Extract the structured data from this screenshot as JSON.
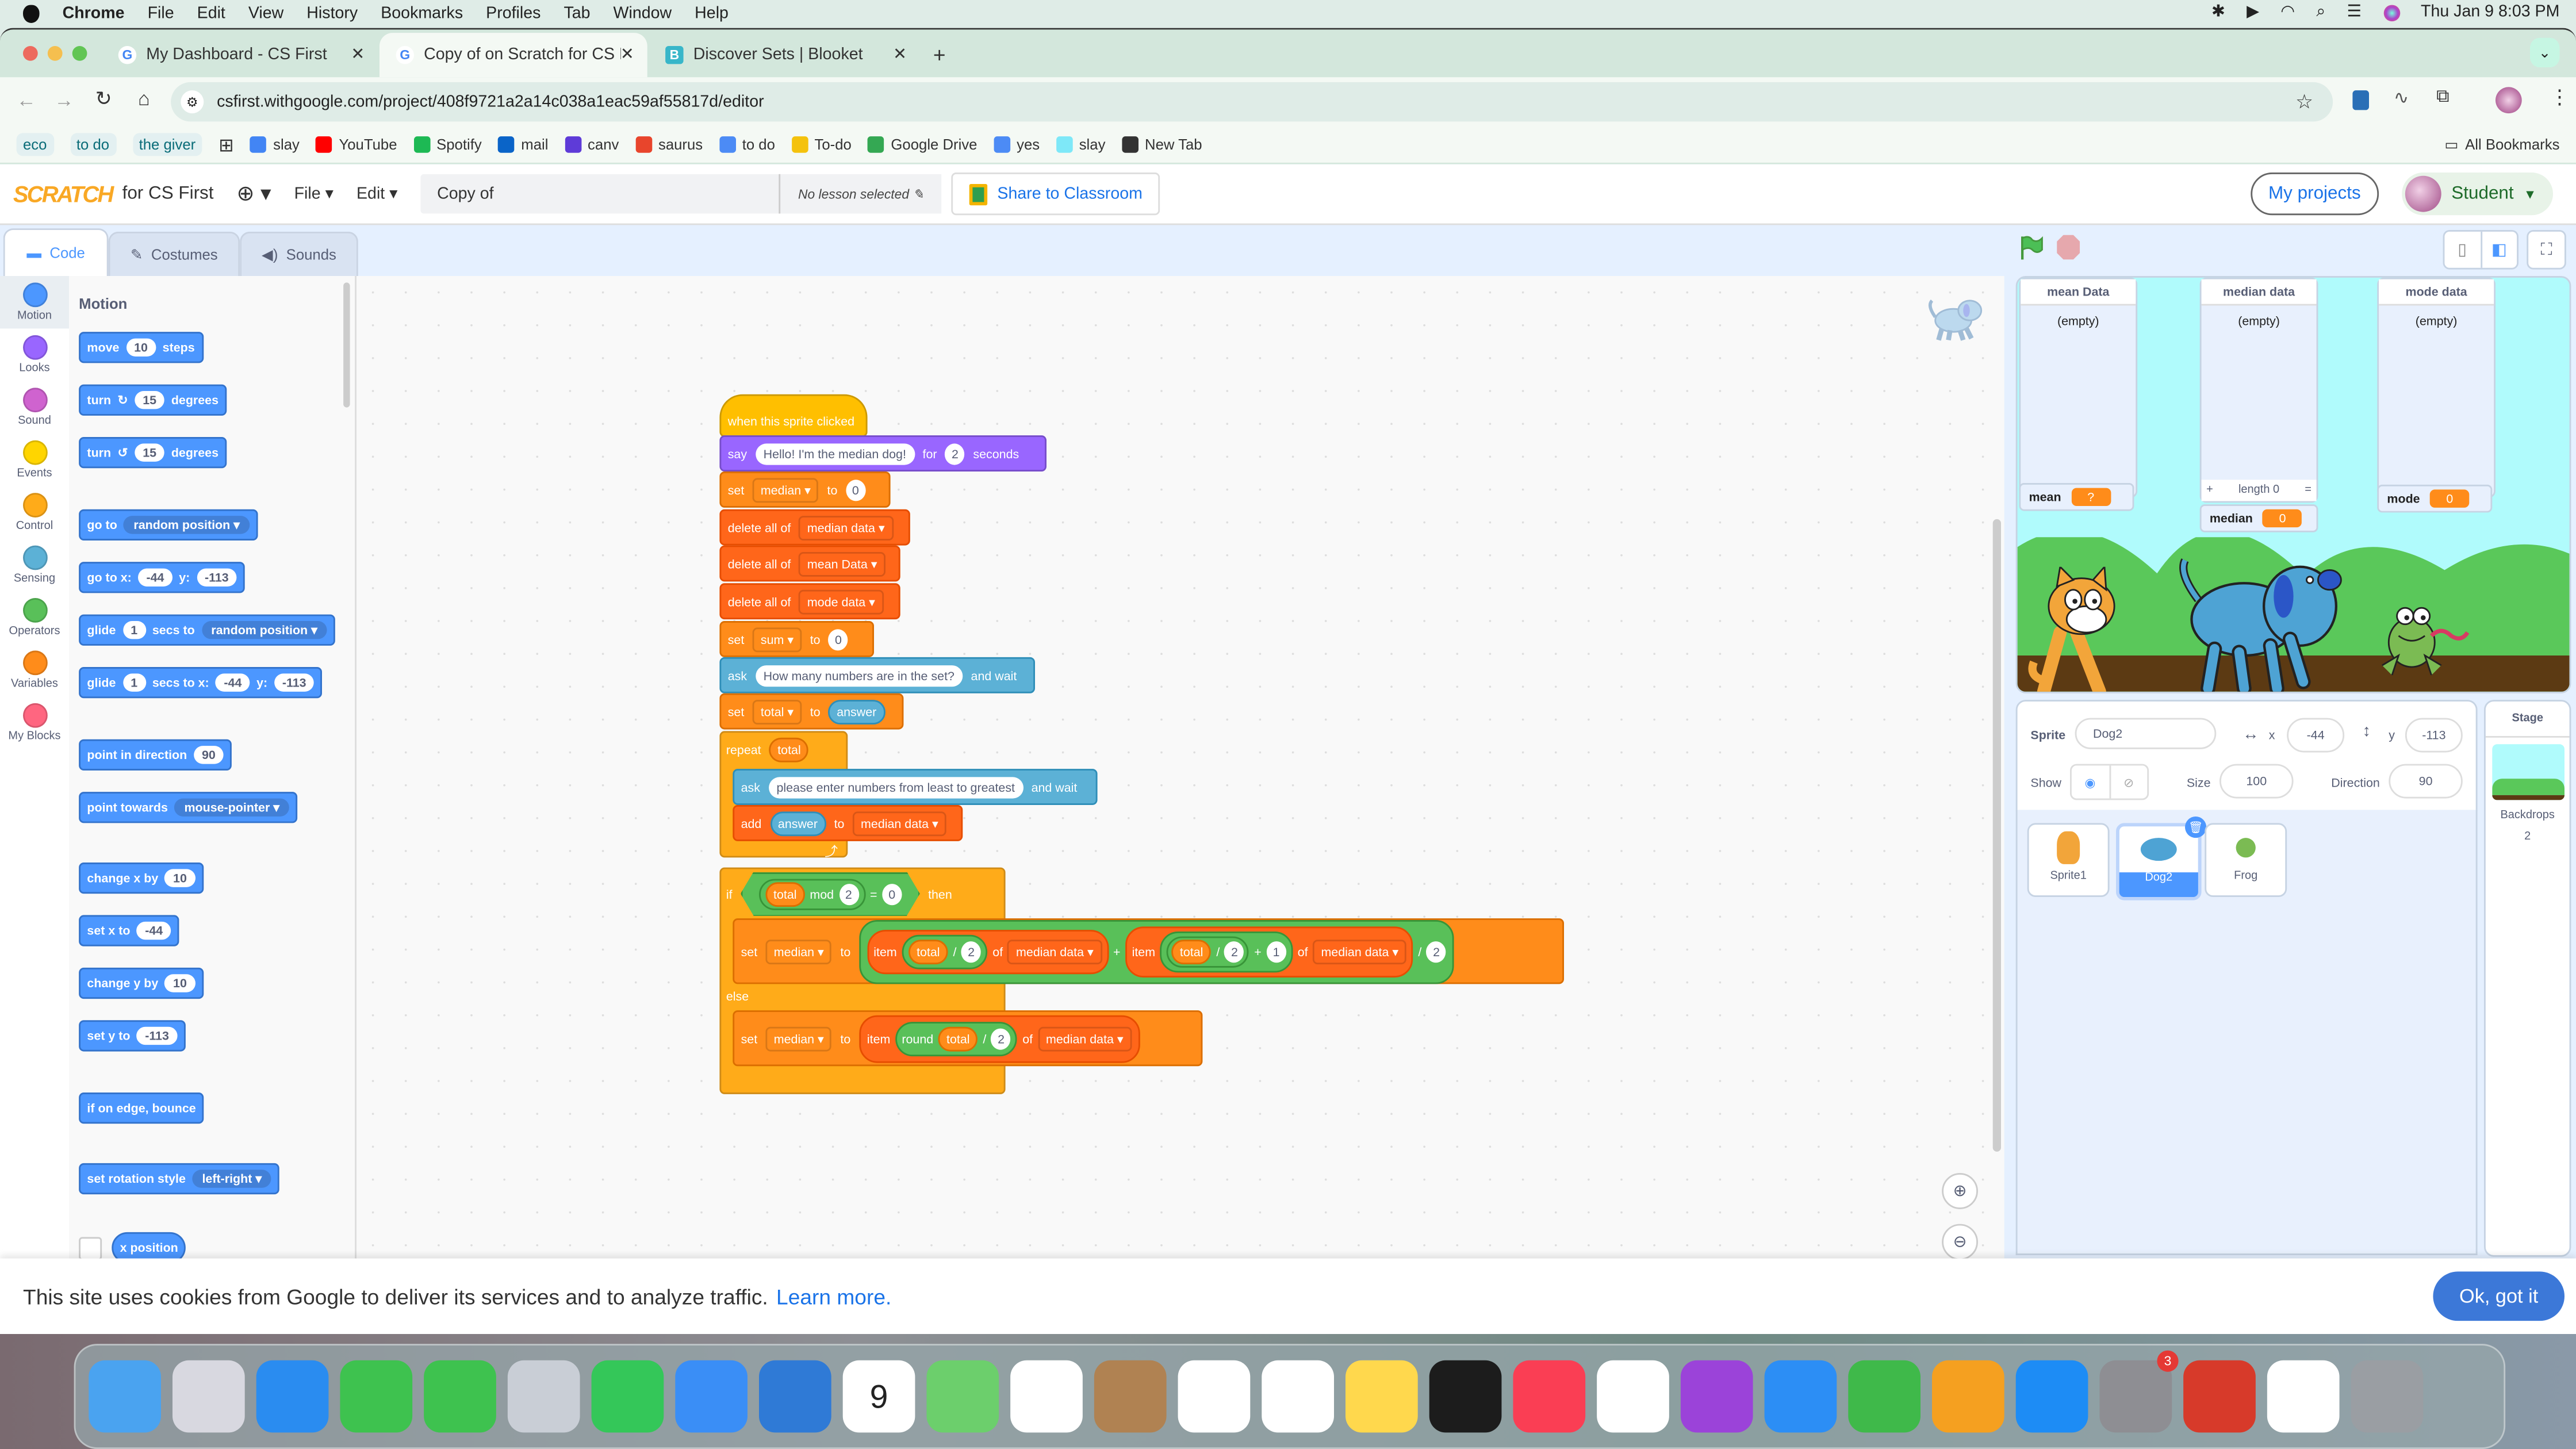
{
  "menubar": {
    "app": "Chrome",
    "items": [
      "File",
      "Edit",
      "View",
      "History",
      "Bookmarks",
      "Profiles",
      "Tab",
      "Window",
      "Help"
    ],
    "clock": "Thu Jan 9  8:03 PM"
  },
  "browser": {
    "tabs": [
      {
        "title": "My Dashboard - CS First",
        "icon": "google-icon",
        "active": false
      },
      {
        "title": "Copy of on Scratch for CS Fir",
        "icon": "google-icon",
        "active": true
      },
      {
        "title": "Discover Sets | Blooket",
        "icon": "blooket-icon",
        "active": false
      }
    ],
    "url": "csfirst.withgoogle.com/project/408f9721a2a14c038a1eac59af55817d/editor",
    "bookmarks": [
      {
        "label": "eco",
        "type": "chip"
      },
      {
        "label": "to do",
        "type": "chip"
      },
      {
        "label": "the giver",
        "type": "chip"
      },
      {
        "label": "slay",
        "icon": "classroom-icon",
        "color": "#4285f4"
      },
      {
        "label": "YouTube",
        "icon": "youtube-icon",
        "color": "#ff0000"
      },
      {
        "label": "Spotify",
        "icon": "spotify-icon",
        "color": "#1db954"
      },
      {
        "label": "mail",
        "icon": "outlook-icon",
        "color": "#0a64c8"
      },
      {
        "label": "canv",
        "icon": "canva-icon",
        "color": "#5e3bd8"
      },
      {
        "label": "saurus",
        "icon": "thesaurus-icon",
        "color": "#e8452c"
      },
      {
        "label": "to do",
        "icon": "docs-icon",
        "color": "#4c8bf5"
      },
      {
        "label": "To-do",
        "icon": "classroom-icon",
        "color": "#f4c20d"
      },
      {
        "label": "Google Drive",
        "icon": "drive-icon",
        "color": "#34a853"
      },
      {
        "label": "yes",
        "icon": "docs-icon",
        "color": "#4c8bf5"
      },
      {
        "label": "slay",
        "icon": "head-icon",
        "color": "#7ee8f8"
      },
      {
        "label": "New Tab",
        "icon": "globe-icon",
        "color": "#333333"
      }
    ],
    "all_bookmarks": "All Bookmarks"
  },
  "scratch": {
    "logo": "SCRATCH",
    "subtitle": "for CS First",
    "menus": [
      "File",
      "Edit"
    ],
    "project_title": "Copy of",
    "lesson": "No lesson selected",
    "share": "Share to Classroom",
    "my_projects": "My projects",
    "user": "Student",
    "tabs": [
      "Code",
      "Costumes",
      "Sounds"
    ],
    "categories": [
      {
        "label": "Motion",
        "color": "#4c97ff"
      },
      {
        "label": "Looks",
        "color": "#9966ff"
      },
      {
        "label": "Sound",
        "color": "#cf63cf"
      },
      {
        "label": "Events",
        "color": "#ffd500"
      },
      {
        "label": "Control",
        "color": "#ffab19"
      },
      {
        "label": "Sensing",
        "color": "#5cb1d6"
      },
      {
        "label": "Operators",
        "color": "#59c059"
      },
      {
        "label": "Variables",
        "color": "#ff8c1a"
      },
      {
        "label": "My Blocks",
        "color": "#ff6680"
      }
    ],
    "palette_title": "Motion",
    "palette": [
      {
        "parts": [
          "move",
          "#10",
          "steps"
        ]
      },
      {
        "parts": [
          "turn",
          "↻",
          "#15",
          "degrees"
        ]
      },
      {
        "parts": [
          "turn",
          "↺",
          "#15",
          "degrees"
        ]
      },
      {
        "parts": [
          "go to",
          "@random position"
        ]
      },
      {
        "parts": [
          "go to x:",
          "#-44",
          "y:",
          "#-113"
        ]
      },
      {
        "parts": [
          "glide",
          "#1",
          "secs to",
          "@random position"
        ]
      },
      {
        "parts": [
          "glide",
          "#1",
          "secs to x:",
          "#-44",
          "y:",
          "#-113"
        ]
      },
      {
        "parts": [
          "point in direction",
          "#90"
        ]
      },
      {
        "parts": [
          "point towards",
          "@mouse-pointer"
        ]
      },
      {
        "parts": [
          "change x by",
          "#10"
        ]
      },
      {
        "parts": [
          "set x to",
          "#-44"
        ]
      },
      {
        "parts": [
          "change y by",
          "#10"
        ]
      },
      {
        "parts": [
          "set y to",
          "#-113"
        ]
      },
      {
        "parts": [
          "if on edge, bounce"
        ]
      },
      {
        "parts": [
          "set rotation style",
          "@left-right"
        ]
      },
      {
        "parts": [
          "x position"
        ]
      }
    ],
    "script": {
      "hat": "when this sprite clicked",
      "say": {
        "kw": "say",
        "msg": "Hello! I'm the median dog!",
        "for": "for",
        "secs": "2",
        "unit": "seconds"
      },
      "set_median": {
        "kw": "set",
        "var": "median",
        "to": "to",
        "val": "0"
      },
      "del1": {
        "kw": "delete all of",
        "list": "median data"
      },
      "del2": {
        "kw": "delete all of",
        "list": "mean Data"
      },
      "del3": {
        "kw": "delete all of",
        "list": "mode data"
      },
      "set_sum": {
        "kw": "set",
        "var": "sum",
        "to": "to",
        "val": "0"
      },
      "ask1": {
        "kw": "ask",
        "q": "How many numbers are in the set?",
        "wait": "and wait"
      },
      "set_total": {
        "kw": "set",
        "var": "total",
        "to": "to",
        "val": "answer"
      },
      "repeat": {
        "kw": "repeat",
        "val": "total"
      },
      "ask2": {
        "kw": "ask",
        "q": "please enter numbers from least to greatest",
        "wait": "and wait"
      },
      "add": {
        "kw": "add",
        "val": "answer",
        "to": "to",
        "list": "median data"
      },
      "if": {
        "kw": "if",
        "a": "total",
        "mod": "mod",
        "b": "2",
        "eq": "=",
        "c": "0",
        "then": "then"
      },
      "set_even": {
        "kw": "set",
        "var": "median",
        "to": "to",
        "item": "item",
        "a": "total",
        "div": "/",
        "b": "2",
        "of": "of",
        "list": "median data",
        "plus": "+",
        "item2": "item",
        "a2": "total",
        "b2": "2",
        "plus2": "+",
        "c2": "1",
        "of2": "of",
        "list2": "median data",
        "div2": "/",
        "d": "2"
      },
      "else": "else",
      "set_odd": {
        "kw": "set",
        "var": "median",
        "to": "to",
        "item": "item",
        "round": "round",
        "a": "total",
        "div": "/",
        "b": "2",
        "of": "of",
        "list": "median data"
      }
    },
    "stage": {
      "lists": [
        {
          "title": "mean Data",
          "content": "(empty)"
        },
        {
          "title": "median data",
          "content": "(empty)",
          "footer": {
            "add": "+",
            "length": "length 0",
            "resize": "="
          }
        },
        {
          "title": "mode data",
          "content": "(empty)"
        }
      ],
      "monitors": [
        {
          "label": "mean",
          "value": "?"
        },
        {
          "label": "median",
          "value": "0"
        },
        {
          "label": "mode",
          "value": "0"
        }
      ]
    },
    "sprite_info": {
      "sprite_label": "Sprite",
      "sprite_name": "Dog2",
      "x_label": "x",
      "x": "-44",
      "y_label": "y",
      "y": "-113",
      "show_label": "Show",
      "size_label": "Size",
      "size": "100",
      "direction_label": "Direction",
      "direction": "90"
    },
    "sprites": [
      {
        "name": "Sprite1",
        "selected": false
      },
      {
        "name": "Dog2",
        "selected": true
      },
      {
        "name": "Frog",
        "selected": false
      }
    ],
    "stage_pane": {
      "title": "Stage",
      "backdrops_label": "Backdrops",
      "backdrops": "2"
    }
  },
  "cookie": {
    "text": "This site uses cookies from Google to deliver its services and to analyze traffic.",
    "link": "Learn more.",
    "button": "Ok, got it"
  },
  "dock": {
    "apps": [
      {
        "name": "finder",
        "color": "#4aa3f0"
      },
      {
        "name": "launchpad",
        "color": "#d8d8e0"
      },
      {
        "name": "safari",
        "color": "#2a8cf0"
      },
      {
        "name": "facetime",
        "color": "#3ec24f"
      },
      {
        "name": "messages",
        "color": "#3ec24f"
      },
      {
        "name": "roblox",
        "color": "#c9ced6"
      },
      {
        "name": "find-my",
        "color": "#34c759"
      },
      {
        "name": "mail",
        "color": "#3a8ef6"
      },
      {
        "name": "weather",
        "color": "#2f7ad6"
      },
      {
        "name": "calendar",
        "color": "#ffffff",
        "label": "9"
      },
      {
        "name": "maps",
        "color": "#6ccf6c"
      },
      {
        "name": "photos",
        "color": "#ffffff"
      },
      {
        "name": "contacts",
        "color": "#b08252"
      },
      {
        "name": "chrome",
        "color": "#ffffff"
      },
      {
        "name": "reminders",
        "color": "#ffffff"
      },
      {
        "name": "notes",
        "color": "#ffd84d"
      },
      {
        "name": "apple-tv",
        "color": "#1c1c1c"
      },
      {
        "name": "music",
        "color": "#fa3e54"
      },
      {
        "name": "news",
        "color": "#ffffff"
      },
      {
        "name": "podcasts",
        "color": "#9b43d9"
      },
      {
        "name": "keynote",
        "color": "#2c8ef5"
      },
      {
        "name": "numbers",
        "color": "#3fb94a"
      },
      {
        "name": "pages",
        "color": "#f5a020"
      },
      {
        "name": "app-store",
        "color": "#1d8cf5"
      },
      {
        "name": "system-settings",
        "color": "#8e8e93",
        "badge": "3"
      },
      {
        "name": "photo-booth",
        "color": "#d73a2a"
      },
      {
        "name": "freeform",
        "color": "#ffffff"
      },
      {
        "name": "trash",
        "color": "#9a9ea3"
      }
    ]
  }
}
